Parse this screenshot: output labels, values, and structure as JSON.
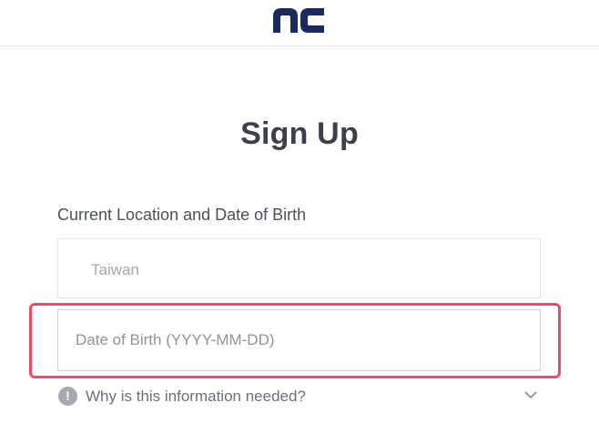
{
  "header": {
    "logo_text": "nc",
    "brand_color": "#1b2a5e"
  },
  "page": {
    "title": "Sign Up"
  },
  "form": {
    "section_label": "Current Location and Date of Birth",
    "country_value": "Taiwan",
    "dob_placeholder": "Date of Birth (YYYY-MM-DD)",
    "dob_value": ""
  },
  "help": {
    "icon_glyph": "!",
    "text": "Why is this information needed?"
  },
  "colors": {
    "highlight": "#ea4d67",
    "muted_text": "#a4a8b0"
  }
}
